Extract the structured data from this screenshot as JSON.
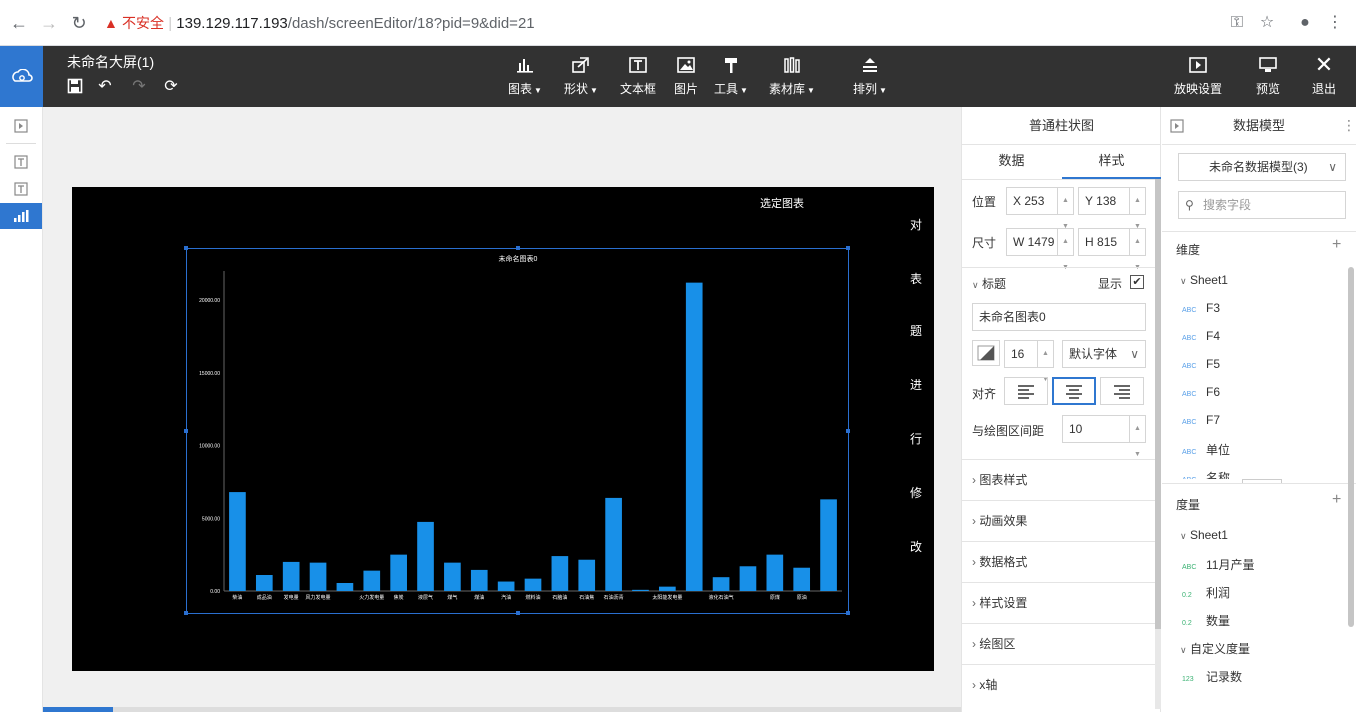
{
  "browser": {
    "security_label": "不安全",
    "url_host": "139.129.117.193",
    "url_path": "/dash/screenEditor/18?pid=9&did=21"
  },
  "app": {
    "title": "未命名大屏(1)",
    "menu": [
      {
        "label": "图表",
        "caret": true
      },
      {
        "label": "形状",
        "caret": true
      },
      {
        "label": "文本框",
        "caret": false
      },
      {
        "label": "图片",
        "caret": false
      },
      {
        "label": "工具",
        "caret": true
      },
      {
        "label": "素材库",
        "caret": true
      },
      {
        "label": "排列",
        "caret": true
      }
    ],
    "right_actions": [
      {
        "label": "放映设置"
      },
      {
        "label": "预览"
      },
      {
        "label": "退出"
      }
    ]
  },
  "stage": {
    "hint": "选定图表",
    "vertical_text": [
      "对",
      "表",
      "题",
      "进",
      "行",
      "修",
      "改"
    ]
  },
  "chart_data": {
    "type": "bar",
    "title": "未命名图表0",
    "xlabel": "",
    "ylabel": "",
    "ylim": [
      0,
      22000
    ],
    "yticks": [
      "0.00",
      "5000.00",
      "10000.00",
      "15000.00",
      "20000.00"
    ],
    "categories": [
      "柴油",
      "成品油",
      "发电量",
      "风力发电量",
      "",
      "火力发电量",
      "焦炭",
      "液层气",
      "煤气",
      "煤油",
      "汽油",
      "燃料油",
      "石脑油",
      "石油焦",
      "石油沥青",
      "",
      "太阳能发电量",
      "",
      "液化石油气",
      "",
      "原煤",
      "原油"
    ],
    "values": [
      6800,
      1100,
      2000,
      1950,
      550,
      1400,
      2500,
      4750,
      1950,
      1450,
      650,
      850,
      2400,
      2150,
      6400,
      80,
      300,
      21200,
      950,
      1700,
      2500,
      1600,
      6300
    ],
    "bar_color": "#1890e8"
  },
  "style_panel": {
    "title": "普通柱状图",
    "tabs": [
      "数据",
      "样式"
    ],
    "position_label": "位置",
    "x_label": "X",
    "x_value": "253",
    "y_label": "Y",
    "y_value": "138",
    "size_label": "尺寸",
    "w_label": "W",
    "w_value": "1479",
    "h_label": "H",
    "h_value": "815",
    "title_section": "标题",
    "show_label": "显示",
    "title_value": "未命名图表0",
    "font_size": "16",
    "font_family": "默认字体",
    "align_label": "对齐",
    "gap_label": "与绘图区间距",
    "gap_value": "10",
    "sections": [
      "图表样式",
      "动画效果",
      "数据格式",
      "样式设置",
      "绘图区",
      "x轴"
    ]
  },
  "data_panel": {
    "title": "数据模型",
    "model_select": "未命名数据模型(3)",
    "search_placeholder": "搜索字段",
    "dimension_header": "维度",
    "dim_group": "Sheet1",
    "dimensions": [
      {
        "type": "ABC",
        "name": "F3"
      },
      {
        "type": "ABC",
        "name": "F4"
      },
      {
        "type": "ABC",
        "name": "F5"
      },
      {
        "type": "ABC",
        "name": "F6"
      },
      {
        "type": "ABC",
        "name": "F7"
      },
      {
        "type": "ABC",
        "name": "单位"
      },
      {
        "type": "ABC",
        "name": "名称"
      }
    ],
    "measure_header": "度量",
    "measure_group": "Sheet1",
    "measures": [
      {
        "type": "ABC",
        "name": "11月产量"
      },
      {
        "type": "0.2",
        "name": "利润"
      },
      {
        "type": "0.2",
        "name": "数量"
      }
    ],
    "custom_group": "自定义度量",
    "custom_measures": [
      {
        "type": "123",
        "name": "记录数"
      }
    ]
  }
}
